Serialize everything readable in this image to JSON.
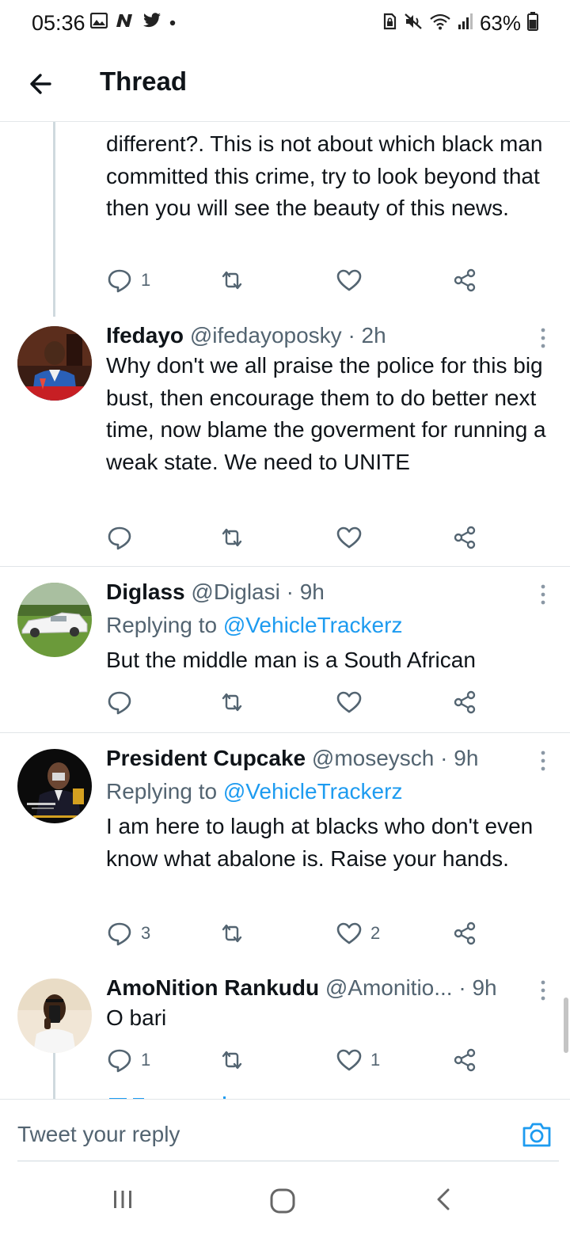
{
  "status_bar": {
    "time": "05:36",
    "battery": "63%",
    "left_icons": [
      "gallery-icon",
      "n-app-icon",
      "twitter-bird-icon",
      "dot-icon"
    ],
    "right_icons": [
      "sim-lock-icon",
      "mute-icon",
      "wifi-icon",
      "signal-icon",
      "battery-icon"
    ]
  },
  "header": {
    "title": "Thread",
    "back_icon": "back-arrow-icon"
  },
  "tweets": [
    {
      "text": "different?.  This is not about which black man committed this crime, try to look beyond that then you will see the beauty of this news.",
      "actions": {
        "reply": "1",
        "retweet": "",
        "like": ""
      }
    },
    {
      "name": "Ifedayo",
      "handle": "@ifedayoposky",
      "time": "· 2h",
      "text": "Why don't we all praise the police for this big bust, then encourage them to do better next time, now blame the goverment for running a weak state. We need to UNITE",
      "actions": {
        "reply": "",
        "retweet": "",
        "like": ""
      }
    },
    {
      "name": "Diglass",
      "handle": "@Diglasi",
      "time": "· 9h",
      "replying_prefix": "Replying to",
      "replying_to": "@VehicleTrackerz",
      "text": "But the middle man is a South African",
      "actions": {
        "reply": "",
        "retweet": "",
        "like": ""
      }
    },
    {
      "name": "President Cupcake",
      "handle": "@moseysch",
      "time": "· 9h",
      "replying_prefix": "Replying to",
      "replying_to": "@VehicleTrackerz",
      "text": "I am here to laugh at blacks who don't even know what abalone is. Raise your hands.",
      "actions": {
        "reply": "3",
        "retweet": "",
        "like": "2"
      }
    },
    {
      "name": "AmoNition Rankudu",
      "handle": "@Amonitio...",
      "time": "· 9h",
      "text": "O bari",
      "actions": {
        "reply": "1",
        "retweet": "",
        "like": "1"
      }
    }
  ],
  "reply_bar": {
    "placeholder": "Tweet your reply",
    "camera_icon": "camera-icon"
  },
  "nav_bar": {
    "buttons": [
      "recents-icon",
      "home-icon",
      "back-icon"
    ]
  },
  "colors": {
    "accent": "#1d9bf0",
    "text_primary": "#0f1419",
    "text_secondary": "#536471",
    "divider": "#e1e5e8",
    "icon_gray": "#536471"
  }
}
